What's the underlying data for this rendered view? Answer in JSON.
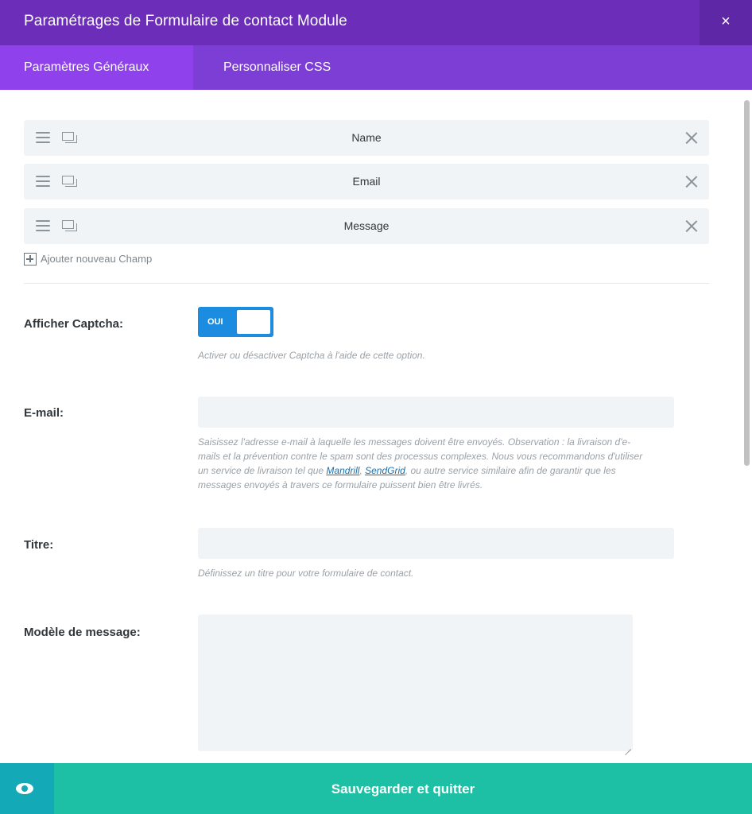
{
  "header": {
    "title": "Paramétrages de Formulaire de contact Module",
    "close_label": "×"
  },
  "tabs": [
    {
      "label": "Paramètres Généraux",
      "active": true
    },
    {
      "label": "Personnaliser CSS",
      "active": false
    }
  ],
  "fields": [
    {
      "label": "Name"
    },
    {
      "label": "Email"
    },
    {
      "label": "Message"
    }
  ],
  "add_field_label": "Ajouter nouveau Champ",
  "captcha": {
    "label": "Afficher Captcha:",
    "toggle_text": "OUI",
    "description": "Activer ou désactiver Captcha à l'aide de cette option."
  },
  "email": {
    "label": "E-mail:",
    "value": "",
    "description_part1": "Saisissez l'adresse e-mail à laquelle les messages doivent être envoyés. Observation : la livraison d'e-mails et la prévention contre le spam sont des processus complexes. Nous vous recommandons d'utiliser un service de livraison tel que ",
    "link1": "Mandrill",
    "separator": ", ",
    "link2": "SendGrid",
    "description_part2": ", ou autre service similaire afin de garantir que les messages envoyés à travers ce formulaire puissent bien être livrés."
  },
  "title_field": {
    "label": "Titre:",
    "value": "",
    "description": "Définissez un titre pour votre formulaire de contact."
  },
  "message_template": {
    "label": "Modèle de message:",
    "value": ""
  },
  "footer": {
    "save_label": "Sauvegarder et quitter"
  },
  "colors": {
    "header": "#6c2eb9",
    "tabs": "#7d3ed6",
    "active_tab": "#8f42ec",
    "toggle": "#1b8ce0",
    "footer": "#1dbfa5",
    "preview": "#13a9b6"
  }
}
